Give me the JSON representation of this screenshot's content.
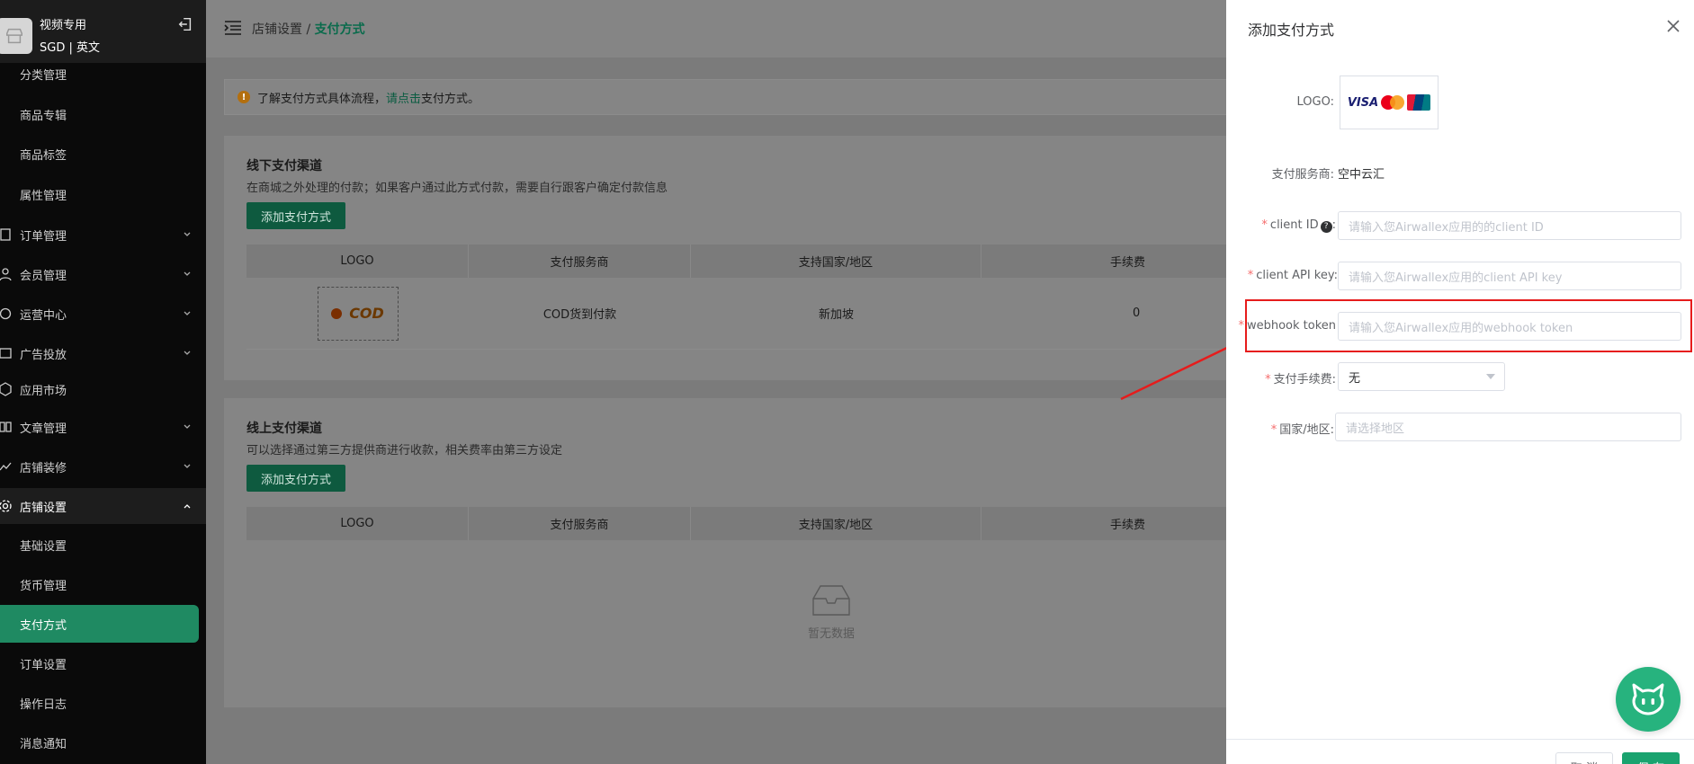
{
  "sidebar": {
    "store_name": "视频专用",
    "store_sub": "SGD | 英文",
    "items": [
      {
        "label": "分类管理",
        "icon": "none"
      },
      {
        "label": "商品专辑",
        "icon": "none"
      },
      {
        "label": "商品标签",
        "icon": "none"
      },
      {
        "label": "属性管理",
        "icon": "none"
      },
      {
        "label": "订单管理",
        "icon": "order-icon"
      },
      {
        "label": "会员管理",
        "icon": "member-icon"
      },
      {
        "label": "运营中心",
        "icon": "operation-icon"
      },
      {
        "label": "广告投放",
        "icon": "ad-icon"
      },
      {
        "label": "应用市场",
        "icon": "app-market-icon"
      },
      {
        "label": "文章管理",
        "icon": "article-icon"
      },
      {
        "label": "店铺装修",
        "icon": "decorate-icon"
      },
      {
        "label": "店铺设置",
        "icon": "settings-icon"
      },
      {
        "label": "基础设置",
        "icon": "none"
      },
      {
        "label": "货币管理",
        "icon": "none"
      },
      {
        "label": "支付方式",
        "icon": "none"
      },
      {
        "label": "订单设置",
        "icon": "none"
      },
      {
        "label": "操作日志",
        "icon": "none"
      },
      {
        "label": "消息通知",
        "icon": "none"
      }
    ]
  },
  "breadcrumb": {
    "parent": "店铺设置",
    "sep": " / ",
    "current": "支付方式"
  },
  "notice": {
    "pre": "了解支付方式具体流程，",
    "link": "请点击",
    "post": "支付方式。"
  },
  "offline": {
    "title": "线下支付渠道",
    "desc": "在商城之外处理的付款；如果客户通过此方式付款，需要自行跟客户确定付款信息",
    "add_btn": "添加支付方式",
    "columns": [
      "LOGO",
      "支付服务商",
      "支持国家/地区",
      "手续费"
    ],
    "rows": [
      {
        "logo": "COD",
        "provider": "COD货到付款",
        "region": "新加坡",
        "fee": "0"
      }
    ]
  },
  "online": {
    "title": "线上支付渠道",
    "desc": "可以选择通过第三方提供商进行收款，相关费率由第三方设定",
    "add_btn": "添加支付方式",
    "columns": [
      "LOGO",
      "支付服务商",
      "支持国家/地区",
      "手续费"
    ],
    "empty": "暂无数据"
  },
  "drawer": {
    "title": "添加支付方式",
    "logo_label": "LOGO:",
    "logo_brands": [
      "VISA"
    ],
    "provider_label": "支付服务商:",
    "provider_value": "空中云汇",
    "client_id_label": "client ID",
    "client_id_placeholder": "请输入您Airwallex应用的的client ID",
    "api_key_label": "client API key:",
    "api_key_placeholder": "请输入您Airwallex应用的client API key",
    "webhook_label": "webhook token",
    "webhook_placeholder": "请输入您Airwallex应用的webhook token",
    "fee_label": "支付手续费:",
    "fee_value": "无",
    "region_label": "国家/地区:",
    "region_placeholder": "请选择地区",
    "cancel": "取 消",
    "save": "保 存"
  },
  "colors": {
    "accent": "#1aa36f",
    "highlight": "#e61c1c",
    "sidebar_active": "#1f8a62"
  }
}
